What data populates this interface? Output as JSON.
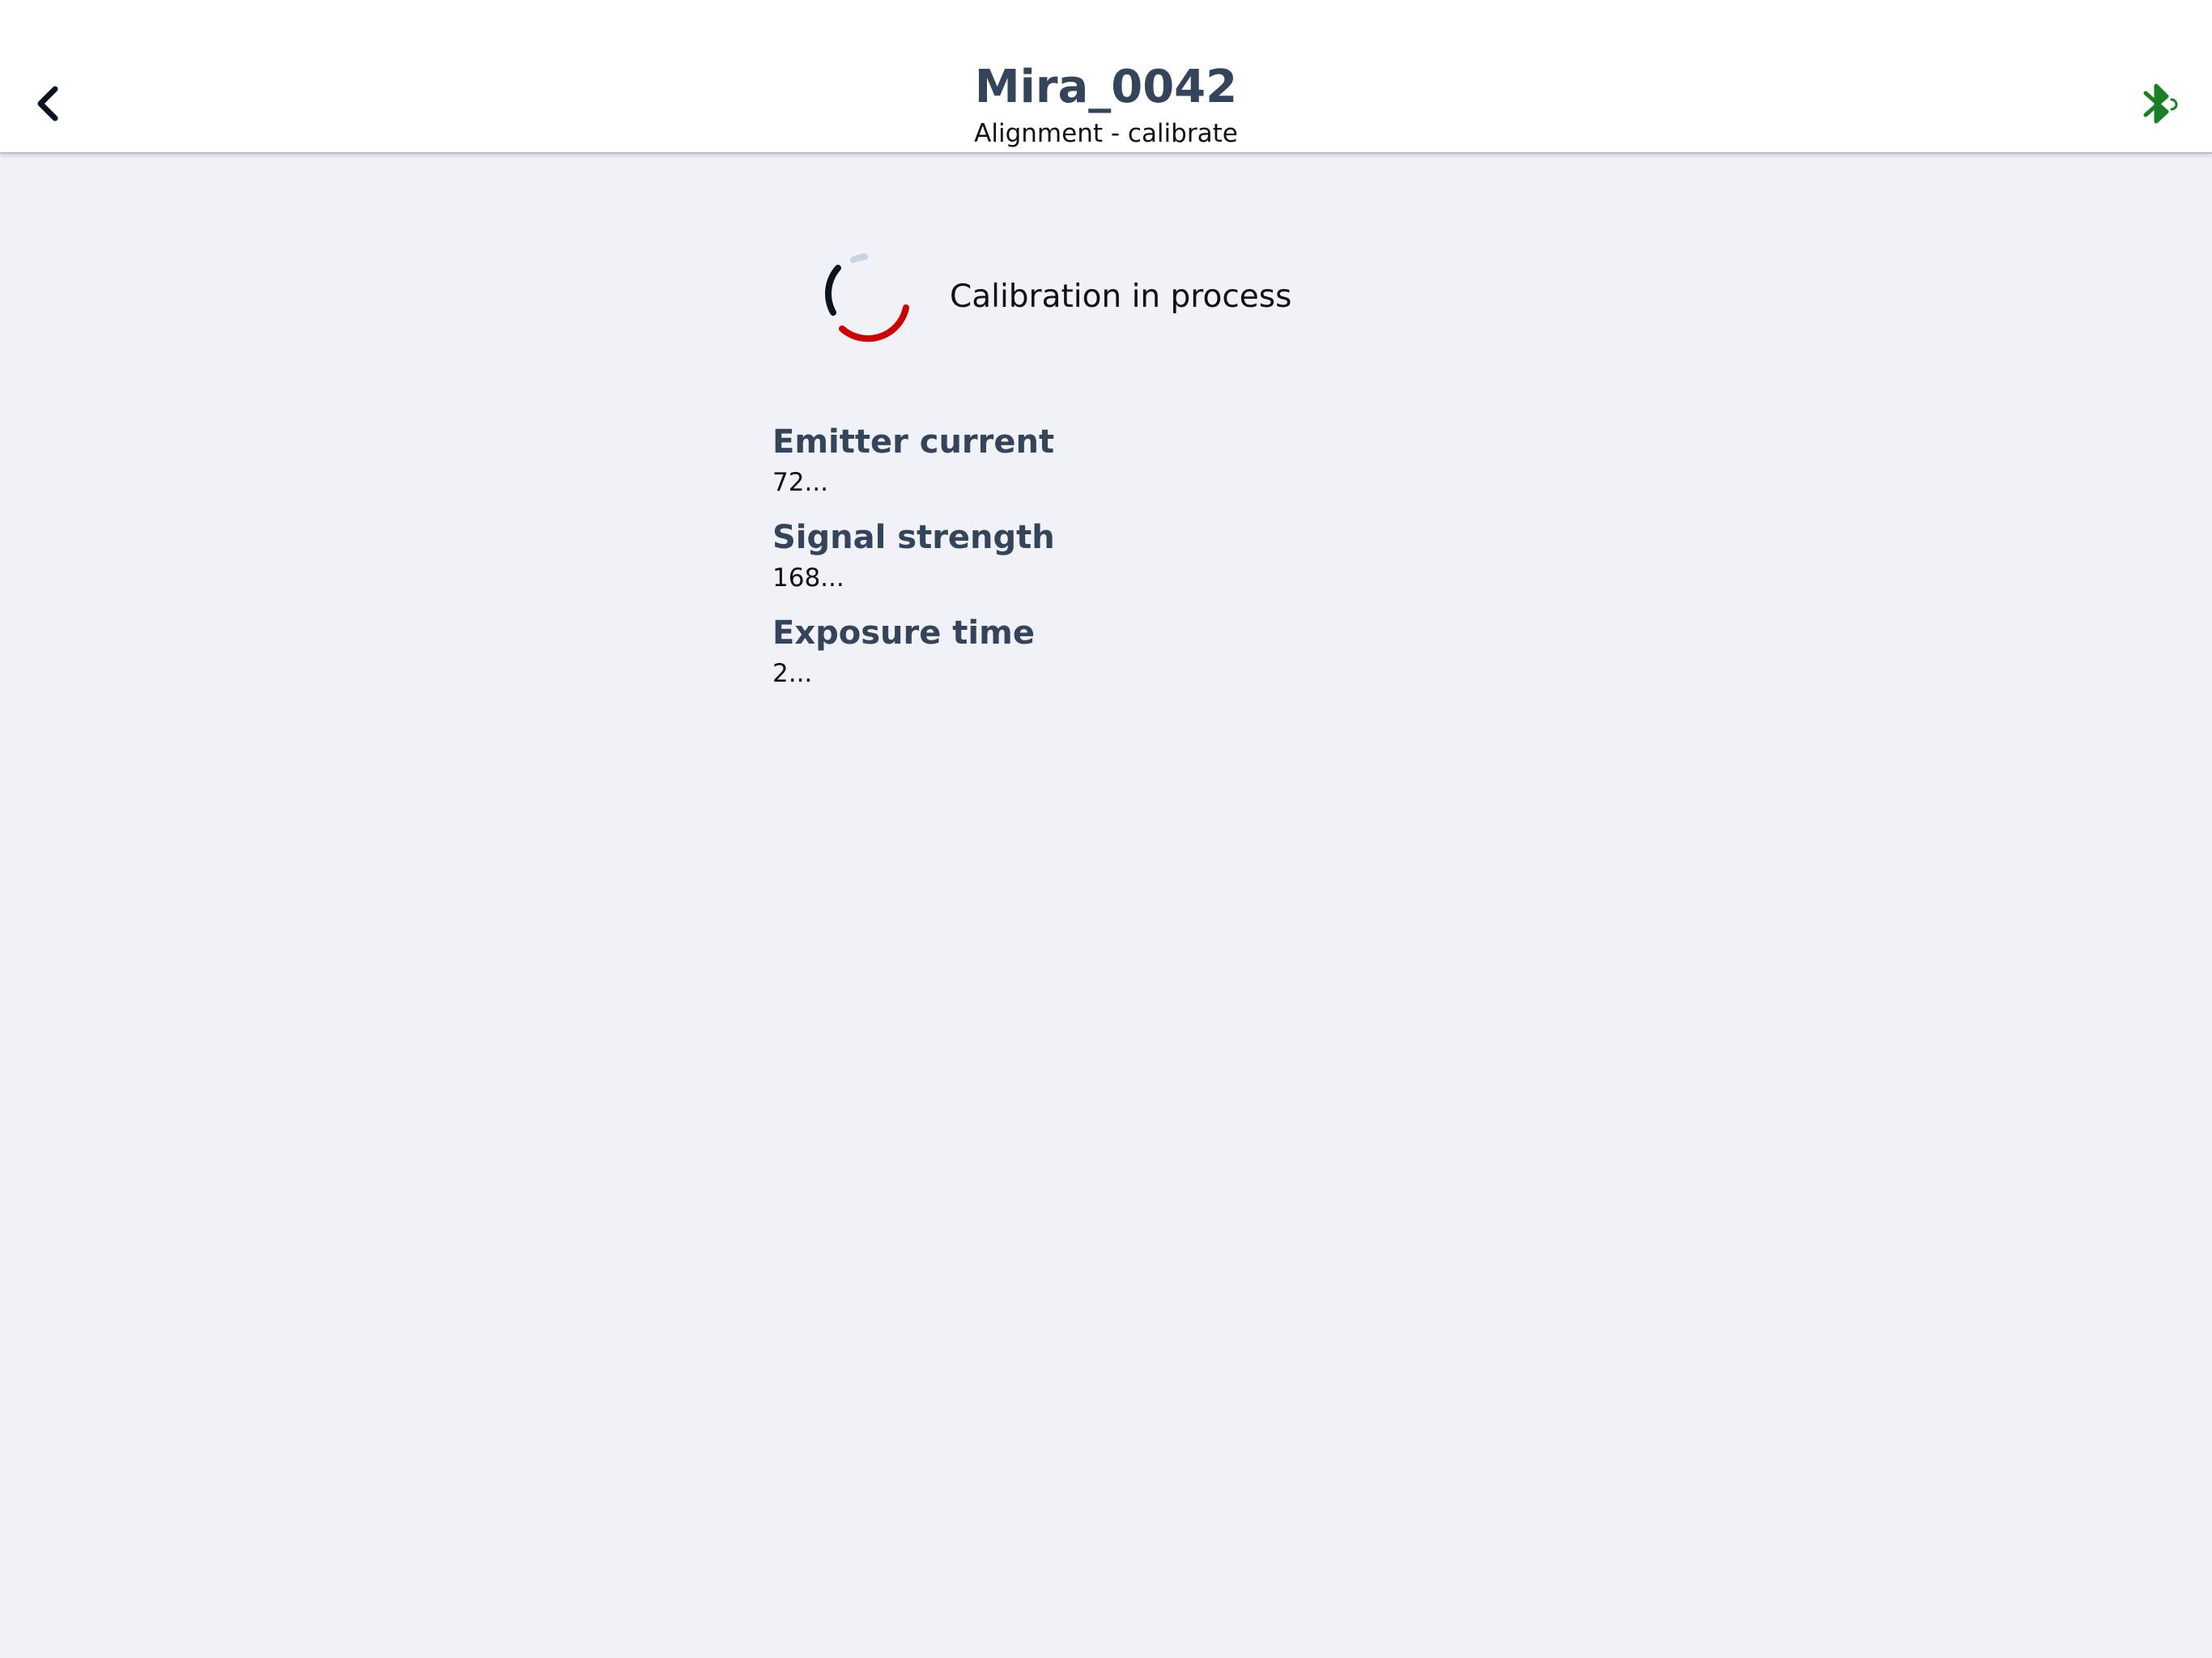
{
  "header": {
    "device_name": "Mira_0042",
    "subtitle": "Alignment - calibrate",
    "back_icon": "chevron-left-icon",
    "connection_icon": "bluetooth-connected-icon",
    "connection_color": "#1a7f25"
  },
  "status": {
    "text": "Calibration in process",
    "spinner_colors": [
      "#0b1220",
      "#cc0000",
      "#c9d3e6"
    ]
  },
  "readings": [
    {
      "label": "Emitter current",
      "value": "72..."
    },
    {
      "label": "Signal strength",
      "value": "168..."
    },
    {
      "label": "Exposure time",
      "value": "2..."
    }
  ]
}
